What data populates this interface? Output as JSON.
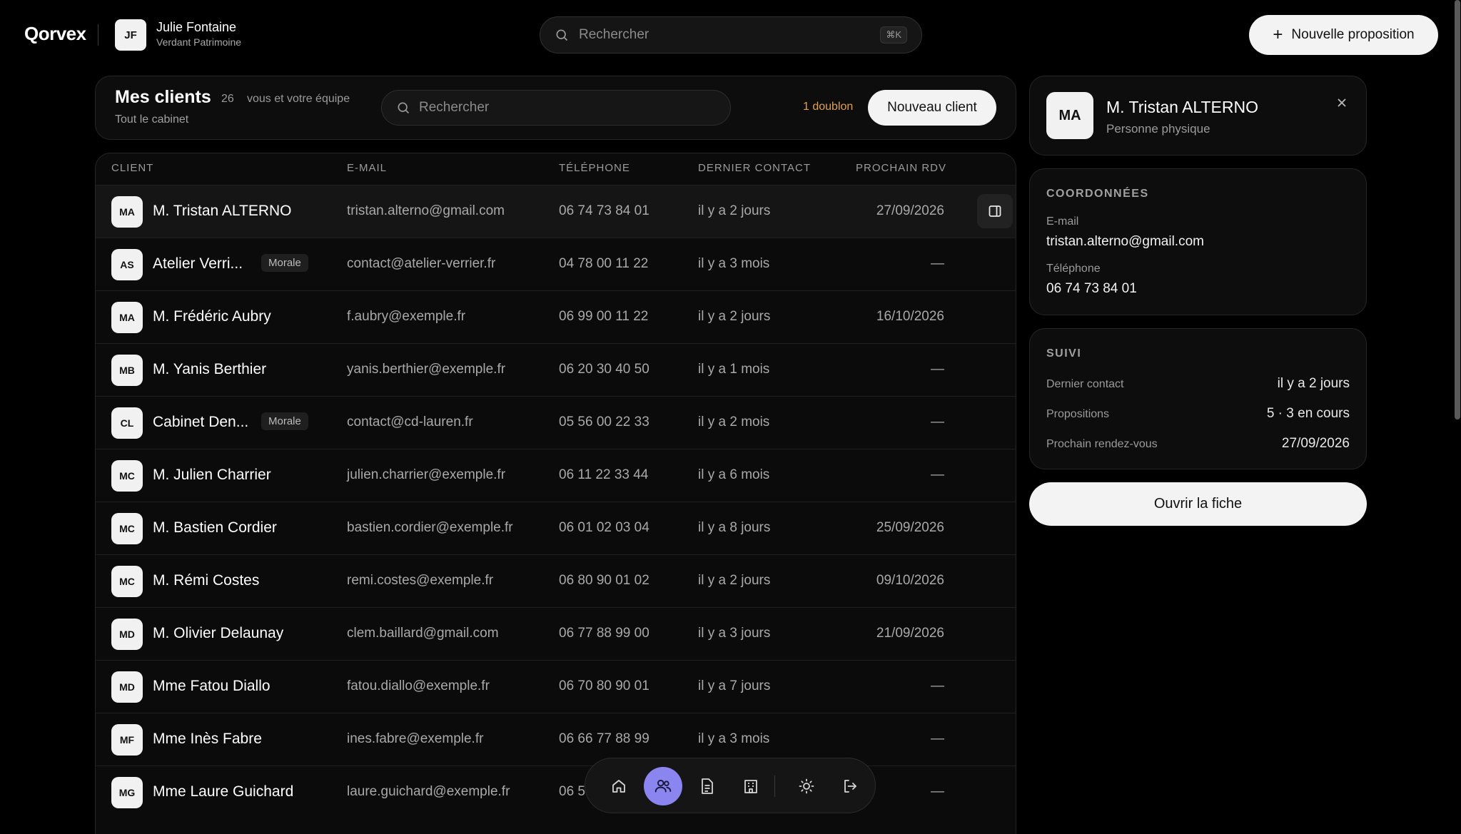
{
  "app": {
    "logo": "Qorvex",
    "user": {
      "initials": "JF",
      "name": "Julie Fontaine",
      "org": "Verdant Patrimoine"
    },
    "search": {
      "placeholder": "Rechercher",
      "shortcut": "⌘K"
    },
    "new_proposal_label": "Nouvelle proposition"
  },
  "clients": {
    "title": "Mes clients",
    "count": "26",
    "scope": "vous et votre équipe",
    "subtitle": "Tout le cabinet",
    "search_placeholder": "Rechercher",
    "duplicates": "1 doublon",
    "new_client_label": "Nouveau client",
    "columns": [
      "CLIENT",
      "E-MAIL",
      "TÉLÉPHONE",
      "DERNIER CONTACT",
      "PROCHAIN RDV"
    ],
    "rows": [
      {
        "initials": "MA",
        "name": "M. Tristan ALTERNO",
        "badge": "",
        "email": "tristan.alterno@gmail.com",
        "phone": "06 74 73 84 01",
        "last_contact": "il y a 2 jours",
        "next_rdv": "27/09/2026"
      },
      {
        "initials": "AS",
        "name": "Atelier Verri...",
        "badge": "Morale",
        "email": "contact@atelier-verrier.fr",
        "phone": "04 78 00 11 22",
        "last_contact": "il y a 3 mois",
        "next_rdv": "—"
      },
      {
        "initials": "MA",
        "name": "M. Frédéric Aubry",
        "badge": "",
        "email": "f.aubry@exemple.fr",
        "phone": "06 99 00 11 22",
        "last_contact": "il y a 2 jours",
        "next_rdv": "16/10/2026"
      },
      {
        "initials": "MB",
        "name": "M. Yanis Berthier",
        "badge": "",
        "email": "yanis.berthier@exemple.fr",
        "phone": "06 20 30 40 50",
        "last_contact": "il y a 1 mois",
        "next_rdv": "—"
      },
      {
        "initials": "CL",
        "name": "Cabinet Den...",
        "badge": "Morale",
        "email": "contact@cd-lauren.fr",
        "phone": "05 56 00 22 33",
        "last_contact": "il y a 2 mois",
        "next_rdv": "—"
      },
      {
        "initials": "MC",
        "name": "M. Julien Charrier",
        "badge": "",
        "email": "julien.charrier@exemple.fr",
        "phone": "06 11 22 33 44",
        "last_contact": "il y a 6 mois",
        "next_rdv": "—"
      },
      {
        "initials": "MC",
        "name": "M. Bastien Cordier",
        "badge": "",
        "email": "bastien.cordier@exemple.fr",
        "phone": "06 01 02 03 04",
        "last_contact": "il y a 8 jours",
        "next_rdv": "25/09/2026"
      },
      {
        "initials": "MC",
        "name": "M. Rémi Costes",
        "badge": "",
        "email": "remi.costes@exemple.fr",
        "phone": "06 80 90 01 02",
        "last_contact": "il y a 2 jours",
        "next_rdv": "09/10/2026"
      },
      {
        "initials": "MD",
        "name": "M. Olivier Delaunay",
        "badge": "",
        "email": "clem.baillard@gmail.com",
        "phone": "06 77 88 99 00",
        "last_contact": "il y a 3 jours",
        "next_rdv": "21/09/2026"
      },
      {
        "initials": "MD",
        "name": "Mme Fatou Diallo",
        "badge": "",
        "email": "fatou.diallo@exemple.fr",
        "phone": "06 70 80 90 01",
        "last_contact": "il y a 7 jours",
        "next_rdv": "—"
      },
      {
        "initials": "MF",
        "name": "Mme Inès Fabre",
        "badge": "",
        "email": "ines.fabre@exemple.fr",
        "phone": "06 66 77 88 99",
        "last_contact": "il y a 3 mois",
        "next_rdv": "—"
      },
      {
        "initials": "MG",
        "name": "Mme Laure Guichard",
        "badge": "",
        "email": "laure.guichard@exemple.fr",
        "phone": "06 5",
        "last_contact": "",
        "next_rdv": "—"
      }
    ]
  },
  "detail": {
    "initials": "MA",
    "name": "M. Tristan ALTERNO",
    "type": "Personne physique",
    "coords_title": "COORDONNÉES",
    "email_label": "E-mail",
    "email": "tristan.alterno@gmail.com",
    "phone_label": "Téléphone",
    "phone": "06 74 73 84 01",
    "suivi_title": "SUIVI",
    "last_contact_label": "Dernier contact",
    "last_contact": "il y a 2 jours",
    "proposals_label": "Propositions",
    "proposals": "5 · 3 en cours",
    "next_rdv_label": "Prochain rendez-vous",
    "next_rdv": "27/09/2026",
    "open_label": "Ouvrir la fiche"
  },
  "dock": {
    "items": [
      "home-icon",
      "users-icon",
      "document-icon",
      "building-icon",
      "sun-icon",
      "logout-icon"
    ],
    "active": "users-icon"
  },
  "colors": {
    "background": "#000000",
    "accent": "#8b85f0",
    "warning": "#e0a04f"
  }
}
